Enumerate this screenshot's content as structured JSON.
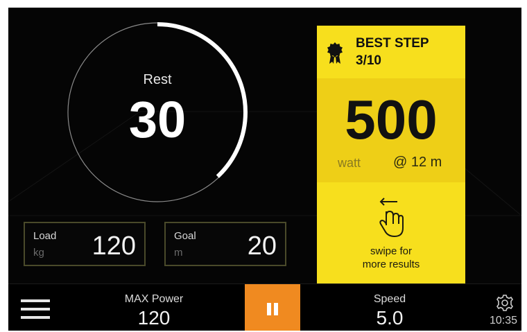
{
  "rest_timer": {
    "label": "Rest",
    "value": "30",
    "progress_fraction": 0.38
  },
  "load": {
    "label": "Load",
    "unit": "kg",
    "value": "120"
  },
  "goal": {
    "label": "Goal",
    "unit": "m",
    "value": "20"
  },
  "best_step": {
    "title": "BEST STEP",
    "step": "3/10",
    "value": "500",
    "unit": "watt",
    "distance": "@ 12 m",
    "swipe_line1": "swipe for",
    "swipe_line2": "more results",
    "award_icon": "award-badge-icon",
    "swipe_icon": "swipe-hand-icon"
  },
  "bottom_bar": {
    "max_power_label": "MAX Power",
    "max_power_value": "120",
    "speed_label": "Speed",
    "speed_value": "5.0",
    "clock": "10:35",
    "menu_icon": "menu-icon",
    "pause_icon": "pause-icon",
    "settings_icon": "gear-icon"
  },
  "colors": {
    "background": "#050505",
    "accent_yellow": "#f7df1d",
    "accent_orange": "#f08a20",
    "ring": "#ffffff"
  }
}
